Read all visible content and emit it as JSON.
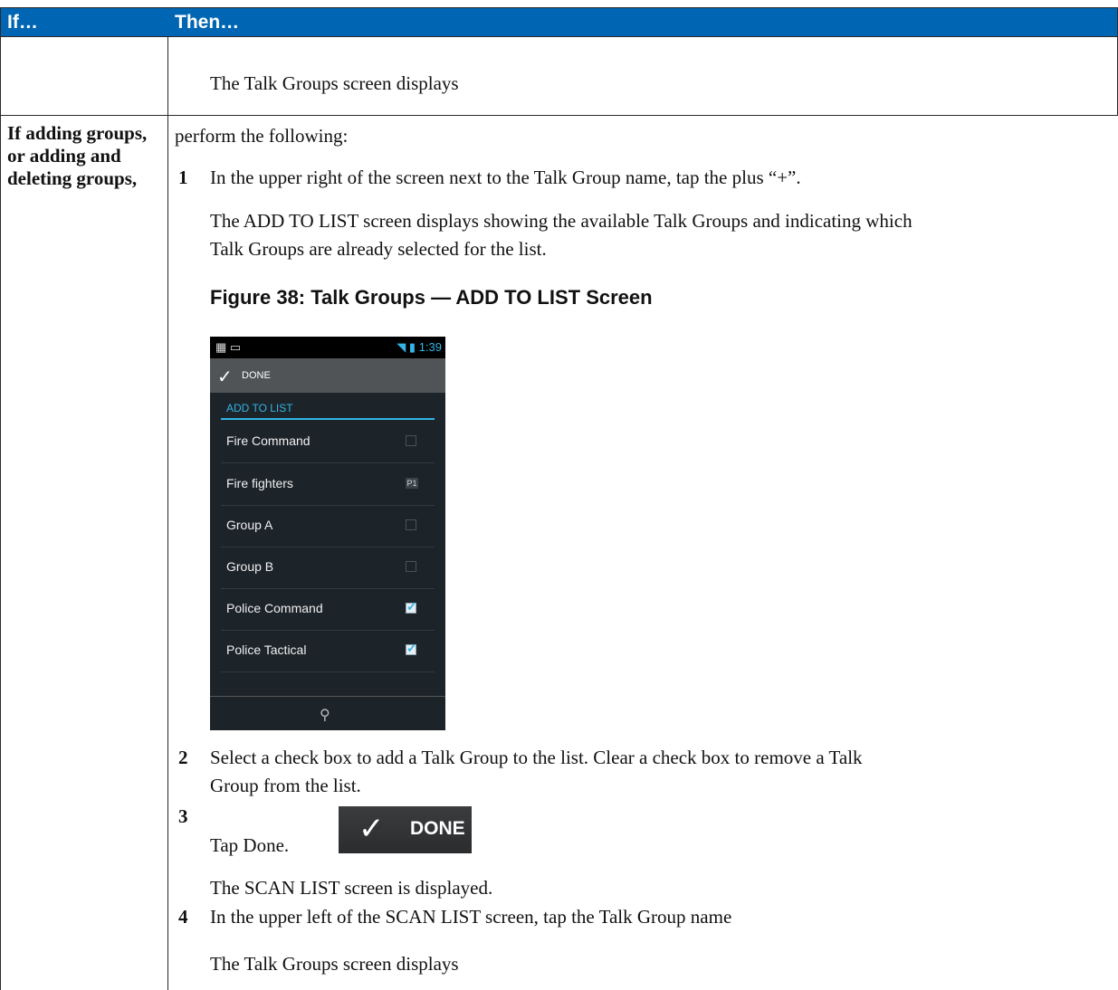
{
  "header": {
    "col_if": "If…",
    "col_then": "Then…"
  },
  "row1": {
    "then_text": "The Talk Groups screen displays"
  },
  "row2": {
    "if_text": "If adding groups, or adding and deleting groups,",
    "intro": "perform the following:",
    "step1_num": "1",
    "step1_text": "In the upper right of the screen next to the Talk Group name, tap the plus “+”.",
    "step1_result_line1": "The ADD TO LIST screen displays showing the available Talk Groups and indicating which",
    "step1_result_line2": "Talk Groups are already selected for the list.",
    "figure_caption": "Figure 38: Talk Groups — ADD TO LIST Screen",
    "step2_num": "2",
    "step2_line1": "Select a check box to add a Talk Group to the list. Clear a check box to remove a Talk",
    "step2_line2": "Group from the list.",
    "step3_num": "3",
    "step3_text": "Tap Done.",
    "step3_result": "The SCAN LIST screen is displayed.",
    "step4_num": "4",
    "step4_text": "In the upper left of the SCAN LIST screen, tap the Talk Group name",
    "step4_result": "The Talk Groups screen displays"
  },
  "phone": {
    "status_time": "1:39",
    "done_label": "DONE",
    "section_label": "ADD TO LIST",
    "items": [
      {
        "label": "Fire Command",
        "state": "unchecked"
      },
      {
        "label": "Fire fighters",
        "state": "P1",
        "badge": "P1"
      },
      {
        "label": "Group A",
        "state": "unchecked"
      },
      {
        "label": "Group B",
        "state": "unchecked"
      },
      {
        "label": "Police Command",
        "state": "checked"
      },
      {
        "label": "Police Tactical",
        "state": "checked"
      }
    ],
    "accent_color": "#33b5e5"
  },
  "done_image": {
    "label": "DONE"
  },
  "colors": {
    "header_bg": "#0066b3",
    "header_text": "#ffffff"
  }
}
